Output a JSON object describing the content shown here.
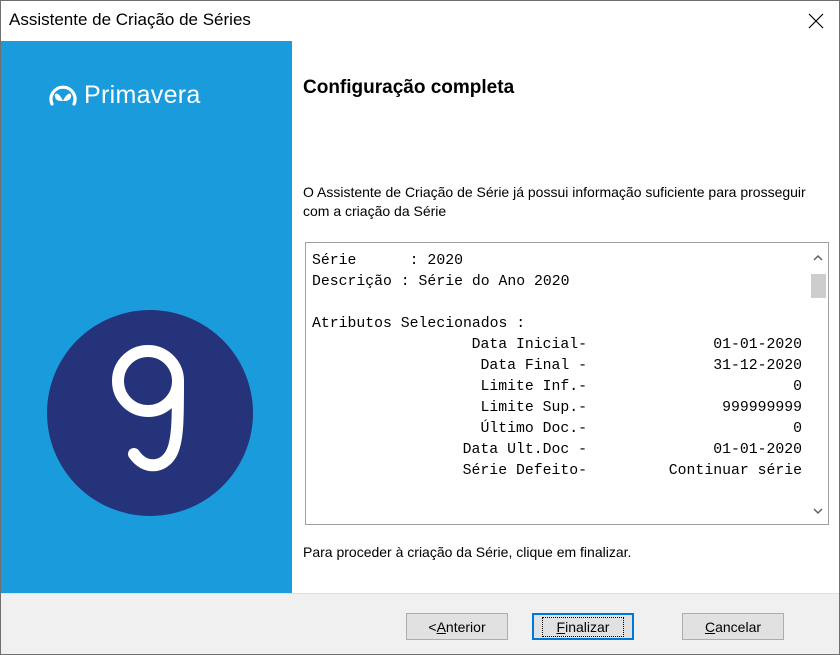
{
  "window": {
    "title": "Assistente de Criação de Séries"
  },
  "sidebar": {
    "brand": "Primavera",
    "badge_icon": "primavera-9-badge"
  },
  "main": {
    "heading": "Configuração completa",
    "intro": "O Assistente de Criação de Série já possui informação suficiente para prosseguir com a criação da Série",
    "summary": {
      "serie_line": "Série      : 2020",
      "descricao_line": "Descrição : Série do Ano 2020",
      "atributos_header": "Atributos Selecionados :",
      "attributes": [
        {
          "label": "Data Inicial-",
          "value": "01-01-2020"
        },
        {
          "label": "Data Final -",
          "value": "31-12-2020"
        },
        {
          "label": "Limite Inf.-",
          "value": "0"
        },
        {
          "label": "Limite Sup.-",
          "value": "999999999"
        },
        {
          "label": "Último Doc.-",
          "value": "0"
        },
        {
          "label": "Data Ult.Doc -",
          "value": "01-01-2020"
        },
        {
          "label": "Série Defeito-",
          "value": "Continuar série"
        }
      ]
    },
    "footer_text": "Para proceder à criação da Série, clique em finalizar."
  },
  "buttons": {
    "anterior": {
      "prefix": "< ",
      "mnemonic": "A",
      "rest": "nterior"
    },
    "finalizar": {
      "prefix": "",
      "mnemonic": "F",
      "rest": "inalizar"
    },
    "cancelar": {
      "prefix": "",
      "mnemonic": "C",
      "rest": "ancelar"
    }
  },
  "colors": {
    "sidebar": "#1a9cdc",
    "badge": "#25347a",
    "accent": "#0078d7"
  }
}
